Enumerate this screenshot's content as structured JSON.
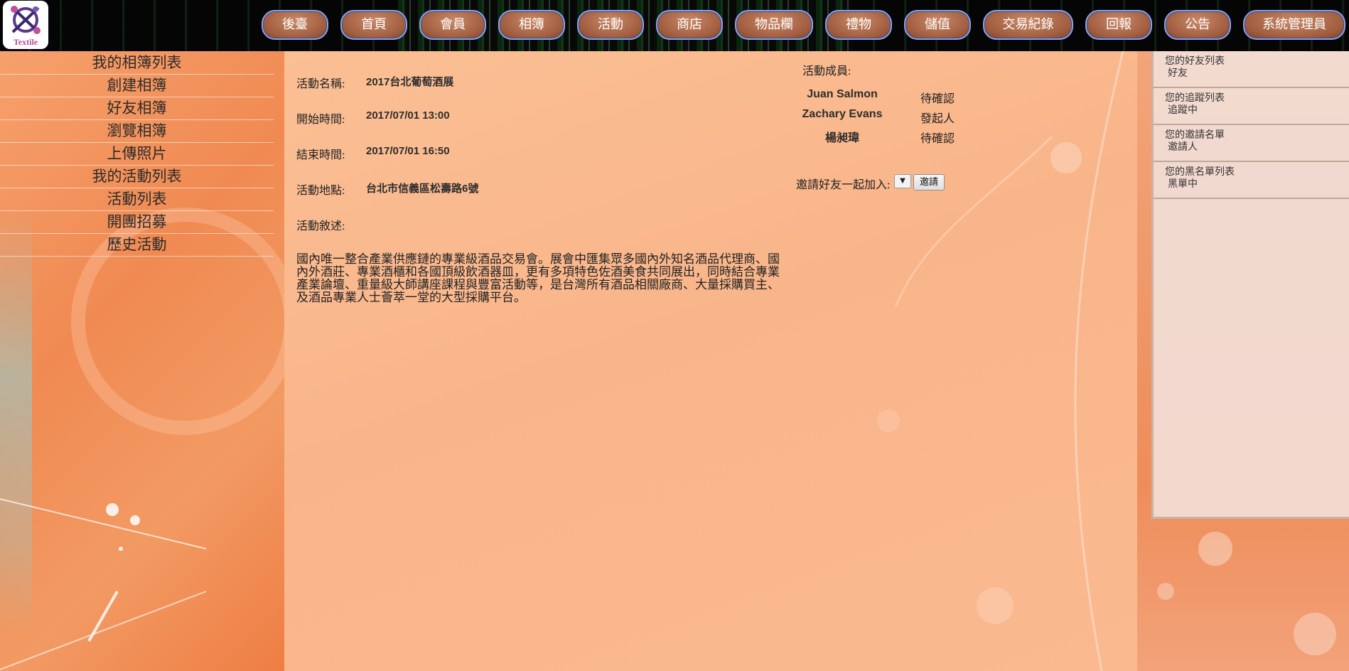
{
  "logo": {
    "text": "Textile"
  },
  "nav": [
    {
      "label": "後臺"
    },
    {
      "label": "首頁"
    },
    {
      "label": "會員"
    },
    {
      "label": "相簿"
    },
    {
      "label": "活動"
    },
    {
      "label": "商店"
    },
    {
      "label": "物品欄"
    },
    {
      "label": "禮物"
    },
    {
      "label": "儲值"
    },
    {
      "label": "交易紀錄"
    },
    {
      "label": "回報"
    },
    {
      "label": "公告"
    },
    {
      "label": "系統管理員"
    }
  ],
  "sidebar": {
    "items": [
      {
        "label": "我的相簿列表"
      },
      {
        "label": "創建相簿"
      },
      {
        "label": "好友相簿"
      },
      {
        "label": "瀏覽相簿"
      },
      {
        "label": "上傳照片"
      },
      {
        "label": "我的活動列表"
      },
      {
        "label": "活動列表"
      },
      {
        "label": "開團招募"
      },
      {
        "label": "歷史活動"
      }
    ]
  },
  "activity": {
    "name_label": "活動名稱:",
    "name": "2017台北葡萄酒展",
    "start_label": "開始時間:",
    "start": "2017/07/01 13:00",
    "end_label": "結束時間:",
    "end": "2017/07/01 16:50",
    "location_label": "活動地點:",
    "location": "台北市信義區松壽路6號",
    "description_label": "活動敘述:",
    "description": "國內唯一整合產業供應鏈的專業級酒品交易會。展會中匯集眾多國內外知名酒品代理商、國內外酒莊、專業酒櫃和各國頂級飲酒器皿，更有多項特色佐酒美食共同展出，同時結合專業產業論壇、重量級大師講座課程與豐富活動等，是台灣所有酒品相關廠商、大量採購買主、及酒品專業人士薈萃一堂的大型採購平台。"
  },
  "members": {
    "label": "活動成員:",
    "list": [
      {
        "name": "Juan Salmon",
        "status": "待確認"
      },
      {
        "name": "Zachary Evans",
        "status": "發起人"
      },
      {
        "name": "楊昶瑋",
        "status": "待確認"
      }
    ]
  },
  "invite": {
    "label": "邀請好友一起加入:",
    "select_value": "",
    "button": "邀請"
  },
  "right_panel": [
    {
      "title": "您的好友列表",
      "sub": "好友"
    },
    {
      "title": "您的追蹤列表",
      "sub": "追蹤中"
    },
    {
      "title": "您的邀請名單",
      "sub": "邀請人"
    },
    {
      "title": "您的黑名單列表",
      "sub": "黑單中"
    }
  ]
}
